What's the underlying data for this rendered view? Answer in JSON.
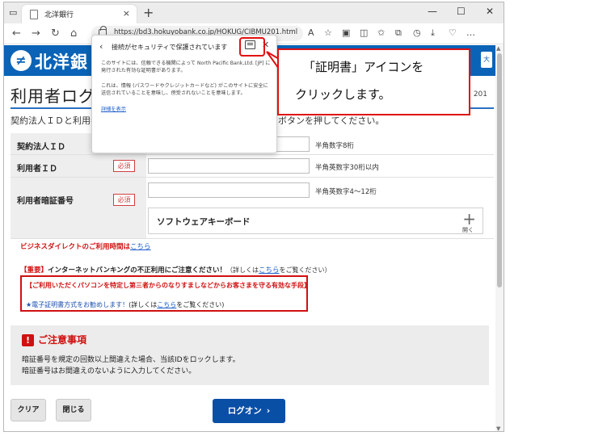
{
  "browser": {
    "tab_title": "北洋銀行",
    "tab_close": "×",
    "new_tab": "+",
    "url": "https://bd3.hokuyobank.co.jp/HOKUG/CIBMU201.html",
    "window_controls": {
      "minimize": "—",
      "maximize": "☐",
      "close": "✕"
    },
    "toolbar_more": "…"
  },
  "header": {
    "bank_name": "北洋銀",
    "right_badge": "大"
  },
  "page": {
    "title": "利用者ログ",
    "screen_code": "201",
    "instruction": "契約法人ＩＤと利用者",
    "instruction_tail": "ボタンを押してください。"
  },
  "form": {
    "corporate_id_label": "契約法人ＩＤ",
    "corporate_id_hint": "半角数字8桁",
    "user_id_label": "利用者ＩＤ",
    "user_id_required": "必須",
    "user_id_hint": "半角英数字30桁以内",
    "password_label": "利用者暗証番号",
    "password_required": "必須",
    "password_hint": "半角英数字4～12桁",
    "software_keyboard": "ソフトウェアキーボード",
    "software_keyboard_open": "開く"
  },
  "notices": {
    "hours_text": "ビジネスダイレクトのご利用時間は",
    "hours_link": "こちら",
    "important_prefix": "【重要】",
    "important_text": "インターネットバンキングの不正利用にご注意ください！",
    "important_paren_open": "（詳しくは",
    "important_link": "こちら",
    "important_paren_close": "をご覧ください）",
    "warning_line": "【ご利用いただくパソコンを特定し第三者からのなりすましなどからお客さまを守る有効な手段】",
    "cert_recommend": "★電子証明書方式をお勧めします！",
    "cert_paren_open": "(詳しくは",
    "cert_link": "こちら",
    "cert_paren_close": "をご覧ください)"
  },
  "caution": {
    "heading": "ご注意事項",
    "line1": "暗証番号を規定の回数以上間違えた場合、当該IDをロックします。",
    "line2": "暗証番号はお間違えのないように入力してください。"
  },
  "buttons": {
    "clear": "クリア",
    "close": "閉じる",
    "logon": "ログオン"
  },
  "security_popup": {
    "heading": "接続がセキュリティで保護されています",
    "para1": "このサイトには、信頼できる機関によって North Pacific Bank,Ltd. [JP] に発行された有効な証明書があります。",
    "para2": "これは、情報 (パスワードやクレジットカードなど) がこのサイトに安全に送信されていることを意味し、傍受されないことを意味します。",
    "details_link": "詳細を表示"
  },
  "annotation": {
    "line1": "「証明書」アイコンを",
    "line2": "クリックします。",
    "color": "#e01010"
  },
  "colors": {
    "brand_blue": "#0a63b6",
    "logon_blue": "#0a4fa6",
    "alert_red": "#d01010"
  }
}
